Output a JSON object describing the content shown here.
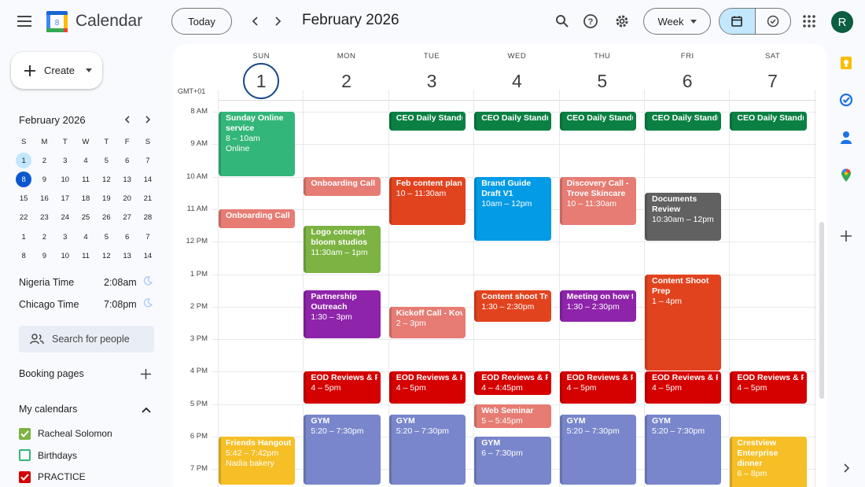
{
  "header": {
    "app_title": "Calendar",
    "logo_text": "8",
    "today_label": "Today",
    "period_title": "February 2026",
    "view_label": "Week",
    "avatar_initial": "R"
  },
  "sidebar": {
    "create_label": "Create",
    "mini_calendar": {
      "title": "February 2026",
      "weekdays": [
        "S",
        "M",
        "T",
        "W",
        "T",
        "F",
        "S"
      ],
      "weeks": [
        [
          "1",
          "2",
          "3",
          "4",
          "5",
          "6",
          "7"
        ],
        [
          "8",
          "9",
          "10",
          "11",
          "12",
          "13",
          "14"
        ],
        [
          "15",
          "16",
          "17",
          "18",
          "19",
          "20",
          "21"
        ],
        [
          "22",
          "23",
          "24",
          "25",
          "26",
          "27",
          "28"
        ],
        [
          "1",
          "2",
          "3",
          "4",
          "5",
          "6",
          "7"
        ],
        [
          "8",
          "9",
          "10",
          "11",
          "12",
          "13",
          "14"
        ]
      ]
    },
    "timezones": [
      {
        "name": "Nigeria Time",
        "time": "2:08am"
      },
      {
        "name": "Chicago Time",
        "time": "7:08pm"
      }
    ],
    "search_people_placeholder": "Search for people",
    "booking_pages_label": "Booking pages",
    "my_calendars_label": "My calendars",
    "calendars": [
      {
        "name": "Racheal Solomon",
        "color": "#7cb342",
        "checked": true
      },
      {
        "name": "Birthdays",
        "color": "#33b679",
        "checked": false
      },
      {
        "name": "PRACTICE",
        "color": "#d50000",
        "checked": true
      }
    ]
  },
  "week": {
    "gmt_label": "GMT+01",
    "days": [
      {
        "name": "SUN",
        "date": "1"
      },
      {
        "name": "MON",
        "date": "2"
      },
      {
        "name": "TUE",
        "date": "3"
      },
      {
        "name": "WED",
        "date": "4"
      },
      {
        "name": "THU",
        "date": "5"
      },
      {
        "name": "FRI",
        "date": "6"
      },
      {
        "name": "SAT",
        "date": "7"
      }
    ],
    "hours": [
      "8 AM",
      "9 AM",
      "10 AM",
      "11 AM",
      "12 PM",
      "1 PM",
      "2 PM",
      "3 PM",
      "4 PM",
      "5 PM",
      "6 PM",
      "7 PM"
    ],
    "events": [
      {
        "day": 0,
        "start": 8,
        "end": 10,
        "title": "Sunday Online service",
        "time": "8 – 10am",
        "extra": "Online",
        "color": "#33b679",
        "wrap": true
      },
      {
        "day": 0,
        "start": 11,
        "end": 11.6,
        "title": "Onboarding Call -",
        "color": "#e67c73"
      },
      {
        "day": 0,
        "start": 18,
        "end": 19.5,
        "title": "Friends Hangout",
        "time": "5:42 – 7:42pm",
        "extra": "Nadia bakery",
        "color": "#f6bf26"
      },
      {
        "day": 1,
        "start": 10,
        "end": 10.6,
        "title": "Onboarding Call -",
        "color": "#e67c73"
      },
      {
        "day": 1,
        "start": 11.5,
        "end": 13,
        "title": "Logo concept bloom studios",
        "time": "11:30am – 1pm",
        "color": "#7cb342",
        "wrap": true
      },
      {
        "day": 1,
        "start": 13.5,
        "end": 15,
        "title": "Partnership Outreach",
        "time": "1:30 – 3pm",
        "color": "#8e24aa",
        "wrap": true
      },
      {
        "day": 1,
        "start": 16,
        "end": 17,
        "title": "EOD Reviews & Pri",
        "time": "4 – 5pm",
        "color": "#d50000"
      },
      {
        "day": 1,
        "start": 17.33,
        "end": 19.5,
        "title": "GYM",
        "time": "5:20 – 7:30pm",
        "color": "#7986cb"
      },
      {
        "day": 2,
        "start": 8,
        "end": 8.6,
        "title": "CEO Daily Standup",
        "color": "#0b8043"
      },
      {
        "day": 2,
        "start": 10,
        "end": 11.5,
        "title": "Feb content plan",
        "time": "10 – 11:30am",
        "color": "#e2431f"
      },
      {
        "day": 2,
        "start": 14,
        "end": 15,
        "title": "Kickoff Call - Kova",
        "time": "2 – 3pm",
        "color": "#e67c73"
      },
      {
        "day": 2,
        "start": 16,
        "end": 17,
        "title": "EOD Reviews & Pri",
        "time": "4 – 5pm",
        "color": "#d50000"
      },
      {
        "day": 2,
        "start": 17.33,
        "end": 19.5,
        "title": "GYM",
        "time": "5:20 – 7:30pm",
        "color": "#7986cb"
      },
      {
        "day": 3,
        "start": 8,
        "end": 8.6,
        "title": "CEO Daily Standup",
        "color": "#0b8043"
      },
      {
        "day": 3,
        "start": 10,
        "end": 12,
        "title": "Brand Guide Draft V1",
        "time": "10am – 12pm",
        "color": "#039be5",
        "wrap": true
      },
      {
        "day": 3,
        "start": 13.5,
        "end": 14.5,
        "title": "Content shoot Trov",
        "time": "1:30 – 2:30pm",
        "color": "#e2431f"
      },
      {
        "day": 3,
        "start": 16,
        "end": 16.75,
        "title": "EOD Reviews & Pri",
        "time": "4 – 4:45pm",
        "color": "#d50000"
      },
      {
        "day": 3,
        "start": 17,
        "end": 17.75,
        "title": "Web Seminar",
        "time": "5 – 5:45pm",
        "color": "#e67c73"
      },
      {
        "day": 3,
        "start": 18,
        "end": 19.5,
        "title": "GYM",
        "time": "6 – 7:30pm",
        "color": "#7986cb"
      },
      {
        "day": 4,
        "start": 8,
        "end": 8.6,
        "title": "CEO Daily Standup",
        "color": "#0b8043"
      },
      {
        "day": 4,
        "start": 10,
        "end": 11.5,
        "title": "Discovery Call - Trove Skincare",
        "time": "10 – 11:30am",
        "color": "#e67c73",
        "wrap": true
      },
      {
        "day": 4,
        "start": 13.5,
        "end": 14.5,
        "title": "Meeting on how to",
        "time": "1:30 – 2:30pm",
        "color": "#8e24aa"
      },
      {
        "day": 4,
        "start": 16,
        "end": 17,
        "title": "EOD Reviews & Pri",
        "time": "4 – 5pm",
        "color": "#d50000"
      },
      {
        "day": 4,
        "start": 17.33,
        "end": 19.5,
        "title": "GYM",
        "time": "5:20 – 7:30pm",
        "color": "#7986cb"
      },
      {
        "day": 5,
        "start": 8,
        "end": 8.6,
        "title": "CEO Daily Standup",
        "color": "#0b8043"
      },
      {
        "day": 5,
        "start": 10.5,
        "end": 12,
        "title": "Documents Review",
        "time": "10:30am – 12pm",
        "color": "#616161",
        "wrap": true
      },
      {
        "day": 5,
        "start": 13,
        "end": 16,
        "title": "Content Shoot Prep",
        "time": "1 – 4pm",
        "color": "#e2431f",
        "wrap": true
      },
      {
        "day": 5,
        "start": 16,
        "end": 17,
        "title": "EOD Reviews & Pri",
        "time": "4 – 5pm",
        "color": "#d50000"
      },
      {
        "day": 5,
        "start": 17.33,
        "end": 19.5,
        "title": "GYM",
        "time": "5:20 – 7:30pm",
        "color": "#7986cb"
      },
      {
        "day": 6,
        "start": 8,
        "end": 8.6,
        "title": "CEO Daily Standup",
        "color": "#0b8043"
      },
      {
        "day": 6,
        "start": 16,
        "end": 17,
        "title": "EOD Reviews & Pri",
        "time": "4 – 5pm",
        "color": "#d50000"
      },
      {
        "day": 6,
        "start": 18,
        "end": 20,
        "title": "Crestview Enterprise dinner",
        "time": "6 – 8pm",
        "color": "#f6bf26",
        "wrap": true
      }
    ]
  }
}
